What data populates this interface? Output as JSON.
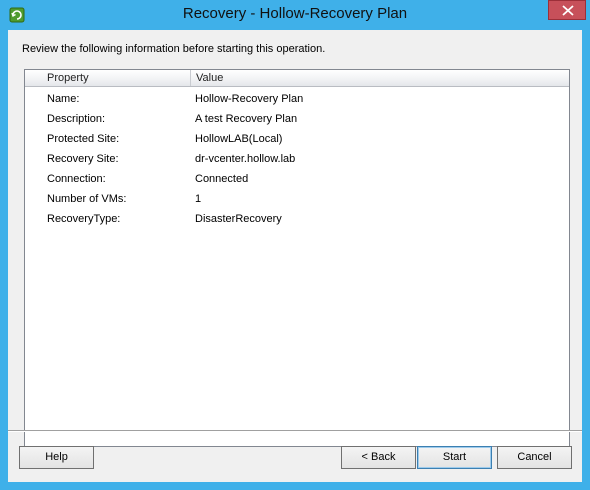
{
  "window": {
    "title": "Recovery - Hollow-Recovery Plan",
    "app_icon": "srm-recovery-icon",
    "close_icon": "close-icon",
    "frame_color": "#3fb0e9",
    "close_color": "#c7505a"
  },
  "intro_text": "Review the following information before starting this operation.",
  "table": {
    "columns": [
      "Property",
      "Value"
    ],
    "rows": [
      {
        "property": "Name:",
        "value": "Hollow-Recovery Plan"
      },
      {
        "property": "Description:",
        "value": "A test Recovery Plan"
      },
      {
        "property": "Protected Site:",
        "value": "HollowLAB(Local)"
      },
      {
        "property": "Recovery Site:",
        "value": "dr-vcenter.hollow.lab"
      },
      {
        "property": "Connection:",
        "value": "Connected"
      },
      {
        "property": "Number of VMs:",
        "value": "1"
      },
      {
        "property": "RecoveryType:",
        "value": "DisasterRecovery"
      }
    ]
  },
  "buttons": {
    "help": "Help",
    "back": "< Back",
    "start": "Start",
    "cancel": "Cancel"
  }
}
